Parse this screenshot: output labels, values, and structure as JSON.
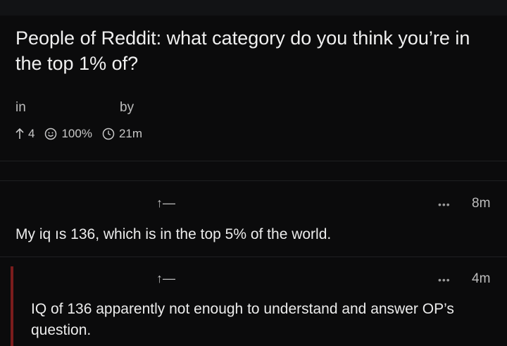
{
  "post": {
    "title": "People of Reddit: what category do you think you’re in the top 1% of?",
    "in_label": "in",
    "by_label": "by",
    "upvotes": "4",
    "upvote_ratio": "100%",
    "age": "21m"
  },
  "comments": [
    {
      "vote_glyph": "↑—",
      "more_glyph": "•••",
      "age": "8m",
      "text": "My iq ıs 136, which is in the top 5% of the world."
    },
    {
      "vote_glyph": "↑—",
      "more_glyph": "•••",
      "age": "4m",
      "text": "IQ of 136 apparently not enough to understand and answer OP’s question."
    }
  ],
  "colors": {
    "background": "#0b0b0c",
    "text": "#ececec",
    "reply_thread_bar": "#7a1c1c"
  }
}
